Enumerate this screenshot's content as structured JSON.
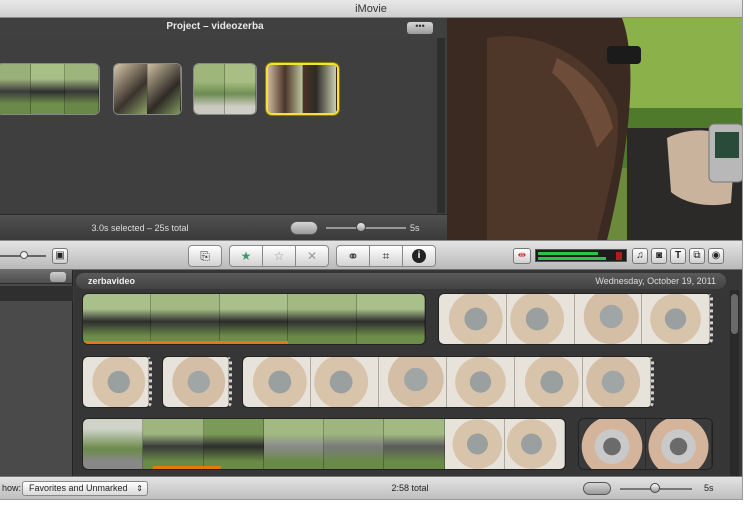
{
  "window": {
    "title": "iMovie"
  },
  "project": {
    "title": "Project – videozerba",
    "more_label": "•••",
    "status": "3.0s selected – 25s total",
    "zoom_label": "5s"
  },
  "toolbar": {
    "tools": [
      {
        "name": "add-to-project-button",
        "icon": "film-add-icon",
        "glyph": "⎘"
      },
      {
        "name": "favorite-button",
        "icon": "star-filled-icon",
        "glyph": "★"
      },
      {
        "name": "unmark-button",
        "icon": "star-outline-icon",
        "glyph": "☆"
      },
      {
        "name": "reject-button",
        "icon": "x-icon",
        "glyph": "✕"
      },
      {
        "name": "voiceover-button",
        "icon": "microphone-icon",
        "glyph": "🎤"
      },
      {
        "name": "crop-button",
        "icon": "crop-icon",
        "glyph": "⌗"
      },
      {
        "name": "inspector-button",
        "icon": "info-icon",
        "glyph": "i"
      }
    ],
    "right_buttons": [
      {
        "name": "music-button",
        "icon": "music-note-icon",
        "glyph": "♫"
      },
      {
        "name": "photo-button",
        "icon": "camera-icon",
        "glyph": "◙"
      },
      {
        "name": "title-button",
        "icon": "title-t-icon",
        "glyph": "T"
      },
      {
        "name": "transition-button",
        "icon": "transition-icon",
        "glyph": "⧉"
      },
      {
        "name": "map-button",
        "icon": "globe-icon",
        "glyph": "◉"
      }
    ]
  },
  "event": {
    "name": "zerbavideo",
    "date": "Wednesday, October 19, 2011"
  },
  "bottom": {
    "show_label": "how:",
    "show_value": "Favorites and Unmarked",
    "total": "2:58 total",
    "zoom_label": "5s"
  },
  "colors": {
    "selection": "#f2e23a",
    "favorite_underline": "#e07b10",
    "audio_meter": "#2ec24a"
  }
}
